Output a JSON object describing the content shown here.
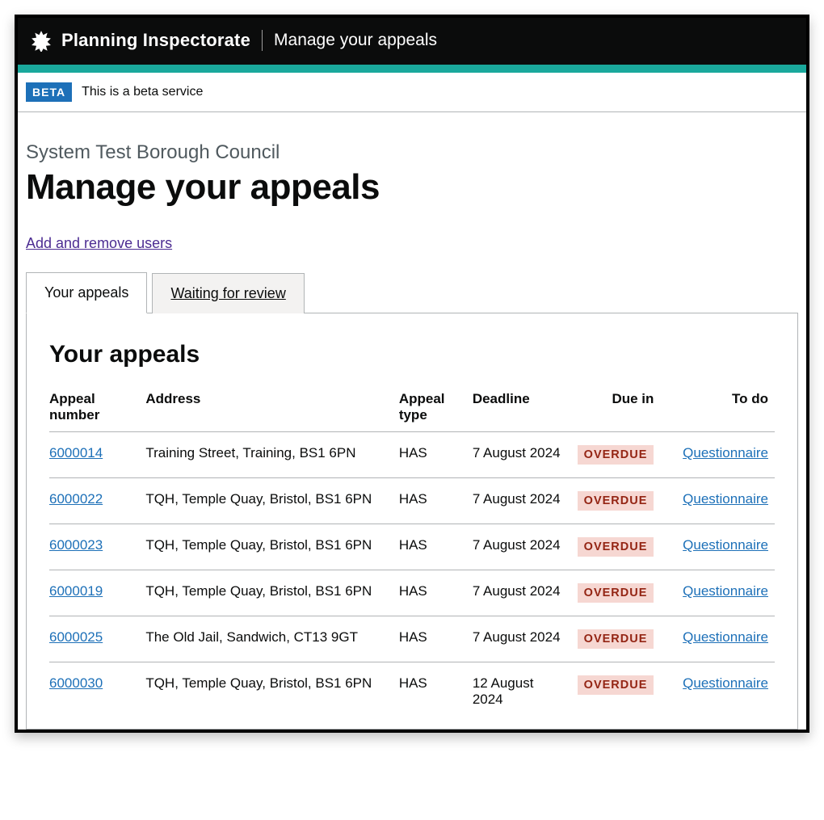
{
  "header": {
    "product": "Planning Inspectorate",
    "service": "Manage your appeals"
  },
  "phase": {
    "tag": "BETA",
    "text": "This is a beta service"
  },
  "caption": "System Test Borough Council",
  "title": "Manage your appeals",
  "manage_users_link": "Add and remove users",
  "tabs": [
    {
      "label": "Your appeals",
      "selected": true
    },
    {
      "label": "Waiting for review",
      "selected": false
    }
  ],
  "panel_heading": "Your appeals",
  "columns": {
    "number": "Appeal number",
    "address": "Address",
    "type": "Appeal type",
    "deadline": "Deadline",
    "due": "Due in",
    "todo": "To do"
  },
  "rows": [
    {
      "number": "6000014",
      "address": "Training Street, Training, BS1 6PN",
      "type": "HAS",
      "deadline": "7 August 2024",
      "due": "OVERDUE",
      "todo": "Questionnaire"
    },
    {
      "number": "6000022",
      "address": "TQH, Temple Quay, Bristol, BS1 6PN",
      "type": "HAS",
      "deadline": "7 August 2024",
      "due": "OVERDUE",
      "todo": "Questionnaire"
    },
    {
      "number": "6000023",
      "address": "TQH, Temple Quay, Bristol, BS1 6PN",
      "type": "HAS",
      "deadline": "7 August 2024",
      "due": "OVERDUE",
      "todo": "Questionnaire"
    },
    {
      "number": "6000019",
      "address": "TQH, Temple Quay, Bristol, BS1 6PN",
      "type": "HAS",
      "deadline": "7 August 2024",
      "due": "OVERDUE",
      "todo": "Questionnaire"
    },
    {
      "number": "6000025",
      "address": "The Old Jail, Sandwich, CT13 9GT",
      "type": "HAS",
      "deadline": "7 August 2024",
      "due": "OVERDUE",
      "todo": "Questionnaire"
    },
    {
      "number": "6000030",
      "address": "TQH, Temple Quay, Bristol, BS1 6PN",
      "type": "HAS",
      "deadline": "12 August 2024",
      "due": "OVERDUE",
      "todo": "Questionnaire"
    }
  ]
}
